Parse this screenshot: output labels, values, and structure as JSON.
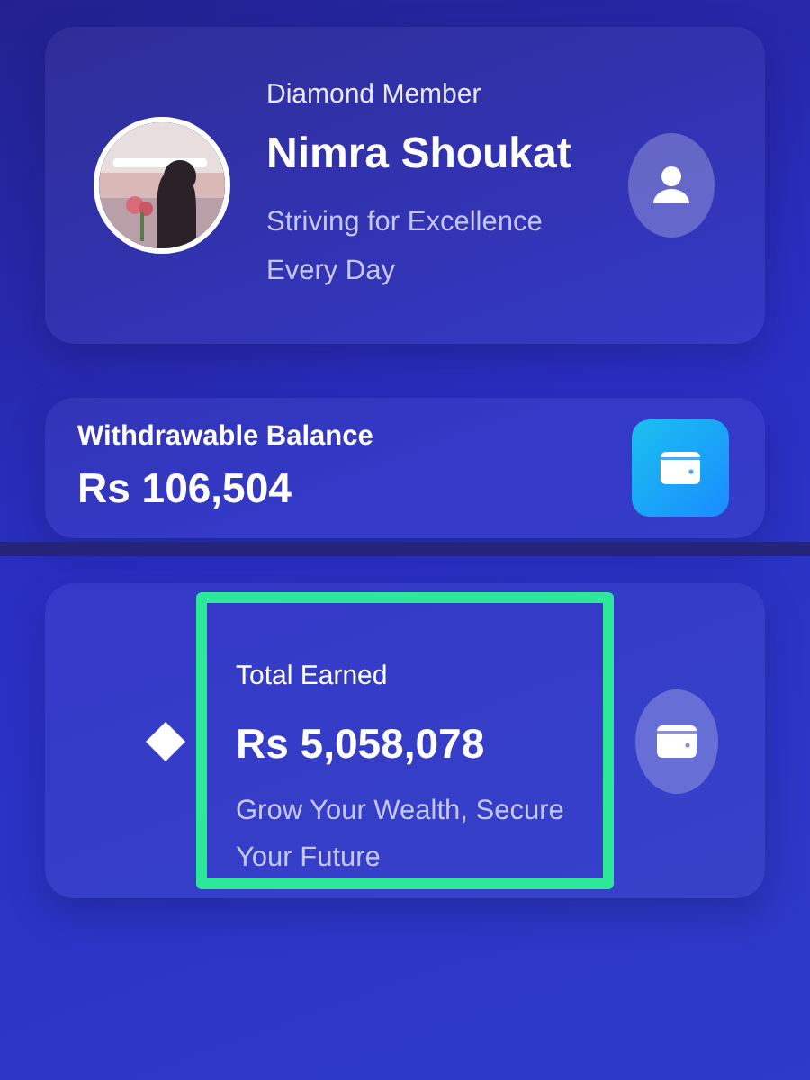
{
  "profile": {
    "tier": "Diamond Member",
    "name": "Nimra Shoukat",
    "tagline": "Striving for Excellence Every Day"
  },
  "withdrawable": {
    "label": "Withdrawable Balance",
    "amount": "Rs 106,504"
  },
  "earned": {
    "label": "Total Earned",
    "amount": "Rs 5,058,078",
    "tagline": "Grow Your Wealth, Secure Your Future",
    "highlighted": true
  }
}
